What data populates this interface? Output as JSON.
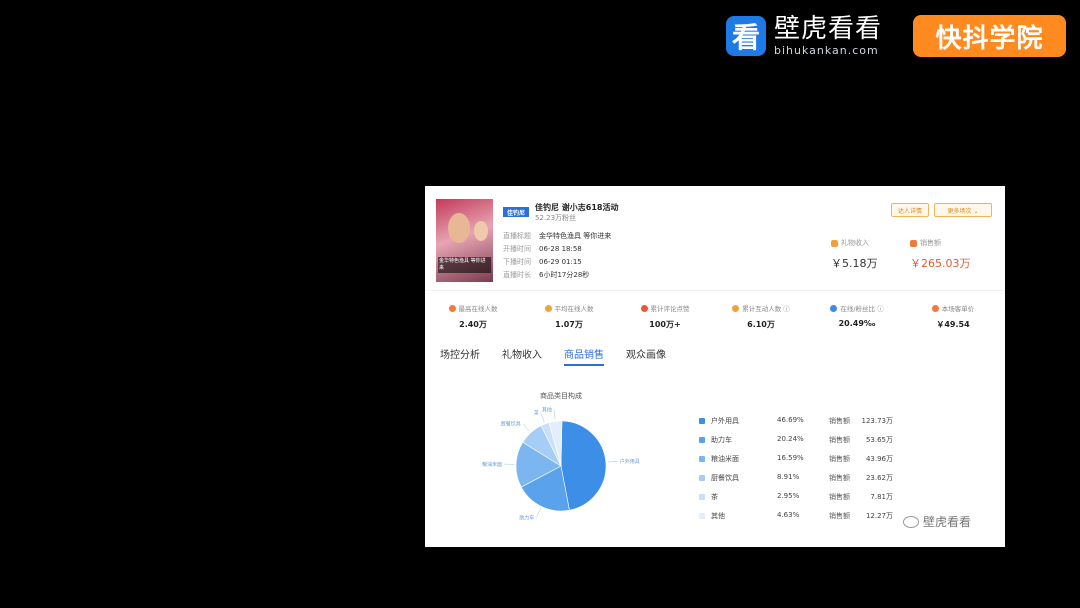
{
  "branding": {
    "bihu_icon": "看",
    "bihu_cn": "壁虎看看",
    "bihu_en": "bihukankan.com",
    "kuaidou": "快抖学院"
  },
  "live": {
    "host_name": "佳钓尼 谢小志618活动",
    "fans": "52.23万粉丝",
    "logo_badge": "佳钓尼",
    "avatar_caption": "金华特色渔具 等你进来",
    "info": [
      {
        "key": "直播标题",
        "value": "金华特色渔具 等你进来"
      },
      {
        "key": "开播时间",
        "value": "06-28 18:58"
      },
      {
        "key": "下播时间",
        "value": "06-29 01:15"
      },
      {
        "key": "直播时长",
        "value": "6小时17分28秒"
      }
    ],
    "buttons": {
      "detail": "达人详情",
      "more": "更多场次 ⌄"
    },
    "kpi": [
      {
        "label": "礼物收入",
        "value": "￥5.18万",
        "color": "#333333",
        "icon_color": "#f0a23a"
      },
      {
        "label": "销售额",
        "value": "￥265.03万",
        "color": "#e85a32",
        "icon_color": "#f07a3a"
      }
    ],
    "stats": [
      {
        "label": "最高在线人数",
        "value": "2.40万",
        "icon_color": "#f07a3a"
      },
      {
        "label": "平均在线人数",
        "value": "1.07万",
        "icon_color": "#f0a23a"
      },
      {
        "label": "累计评论点赞",
        "value": "100万+",
        "icon_color": "#e85a32"
      },
      {
        "label": "累计互动人数 ⓘ",
        "value": "6.10万",
        "icon_color": "#f0a23a"
      },
      {
        "label": "在线/粉丝比 ⓘ",
        "value": "20.49‰",
        "icon_color": "#3a8ae8"
      },
      {
        "label": "本场客单价",
        "value": "￥49.54",
        "icon_color": "#f07a3a"
      }
    ],
    "tabs": [
      {
        "label": "场控分析",
        "active": false
      },
      {
        "label": "礼物收入",
        "active": false
      },
      {
        "label": "商品销售",
        "active": true
      },
      {
        "label": "观众画像",
        "active": false
      }
    ]
  },
  "chart_data": {
    "type": "pie",
    "title": "商品类目构成",
    "slices": [
      {
        "name": "户外用具",
        "percent": 46.69,
        "sales_label": "销售额",
        "sales": "123.73万",
        "color": "#3d8ee6"
      },
      {
        "name": "助力车",
        "percent": 20.24,
        "sales_label": "销售额",
        "sales": "53.65万",
        "color": "#5ba2ec"
      },
      {
        "name": "粮油米面",
        "percent": 16.59,
        "sales_label": "销售额",
        "sales": "43.96万",
        "color": "#7cb6f0"
      },
      {
        "name": "厨餐饮具",
        "percent": 8.91,
        "sales_label": "销售额",
        "sales": "23.62万",
        "color": "#a5cdf5"
      },
      {
        "name": "茶",
        "percent": 2.95,
        "sales_label": "销售额",
        "sales": "7.81万",
        "color": "#c8e0f8"
      },
      {
        "name": "其他",
        "percent": 4.63,
        "sales_label": "销售额",
        "sales": "12.27万",
        "color": "#e3eefb"
      }
    ],
    "pie_labels": [
      "户外用具",
      "助力车",
      "粮油米面",
      "厨餐饮具",
      "茶",
      "其他"
    ],
    "percent_labels": [
      "46.69%",
      "20.24%",
      "16.59%",
      "8.91%",
      "2.95%",
      "4.63%"
    ]
  },
  "watermark": "壁虎看看"
}
